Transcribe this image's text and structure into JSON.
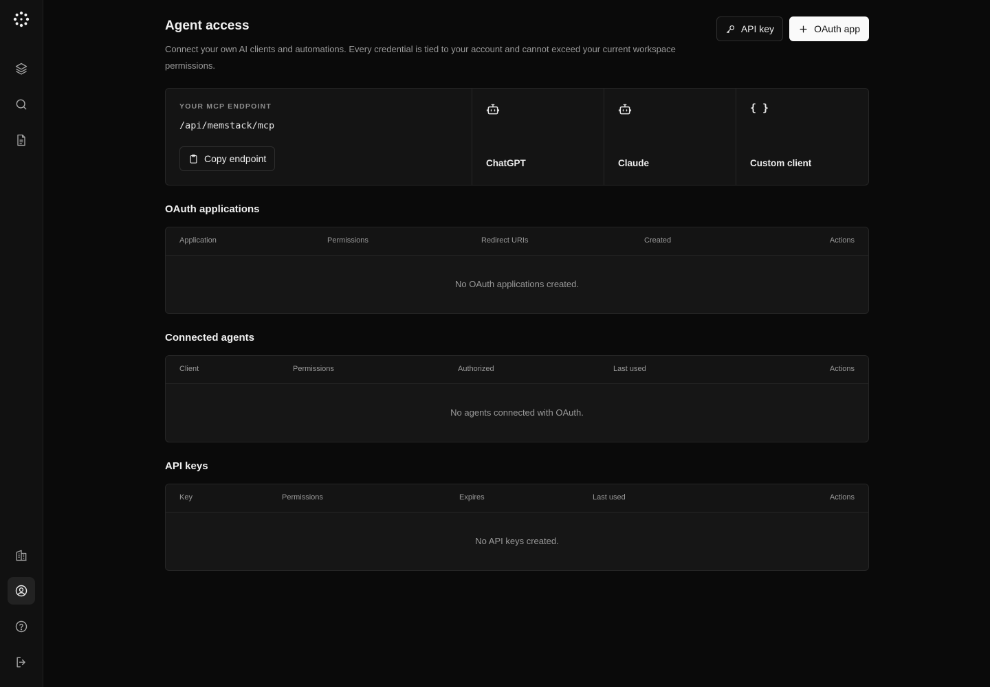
{
  "header": {
    "title": "Agent access",
    "description": "Connect your own AI clients and automations. Every credential is tied to your account and cannot exceed your current workspace permissions.",
    "api_key_label": "API key",
    "oauth_app_label": "OAuth app"
  },
  "endpoint": {
    "label": "YOUR MCP ENDPOINT",
    "path": "/api/memstack/mcp",
    "copy_label": "Copy endpoint"
  },
  "clients": [
    {
      "name": "ChatGPT",
      "icon": "bot-icon"
    },
    {
      "name": "Claude",
      "icon": "bot-icon"
    },
    {
      "name": "Custom client",
      "icon": "braces-icon",
      "glyph": "{ }"
    }
  ],
  "oauth_apps": {
    "title": "OAuth applications",
    "columns": [
      "Application",
      "Permissions",
      "Redirect URIs",
      "Created",
      "Actions"
    ],
    "empty": "No OAuth applications created."
  },
  "connected_agents": {
    "title": "Connected agents",
    "columns": [
      "Client",
      "Permissions",
      "Authorized",
      "Last used",
      "Actions"
    ],
    "empty": "No agents connected with OAuth."
  },
  "api_keys": {
    "title": "API keys",
    "columns": [
      "Key",
      "Permissions",
      "Expires",
      "Last used",
      "Actions"
    ],
    "empty": "No API keys created."
  },
  "sidebar": {
    "items": [
      {
        "icon": "layers-icon"
      },
      {
        "icon": "search-icon"
      },
      {
        "icon": "document-icon"
      },
      {
        "icon": "building-icon"
      },
      {
        "icon": "user-circle-icon",
        "active": true
      },
      {
        "icon": "help-icon"
      },
      {
        "icon": "logout-icon"
      }
    ]
  },
  "colors": {
    "background": "#0a0a0a",
    "sidebar": "#111111",
    "card": "#141414",
    "border": "#262626",
    "primary_button": "#fafafa"
  }
}
